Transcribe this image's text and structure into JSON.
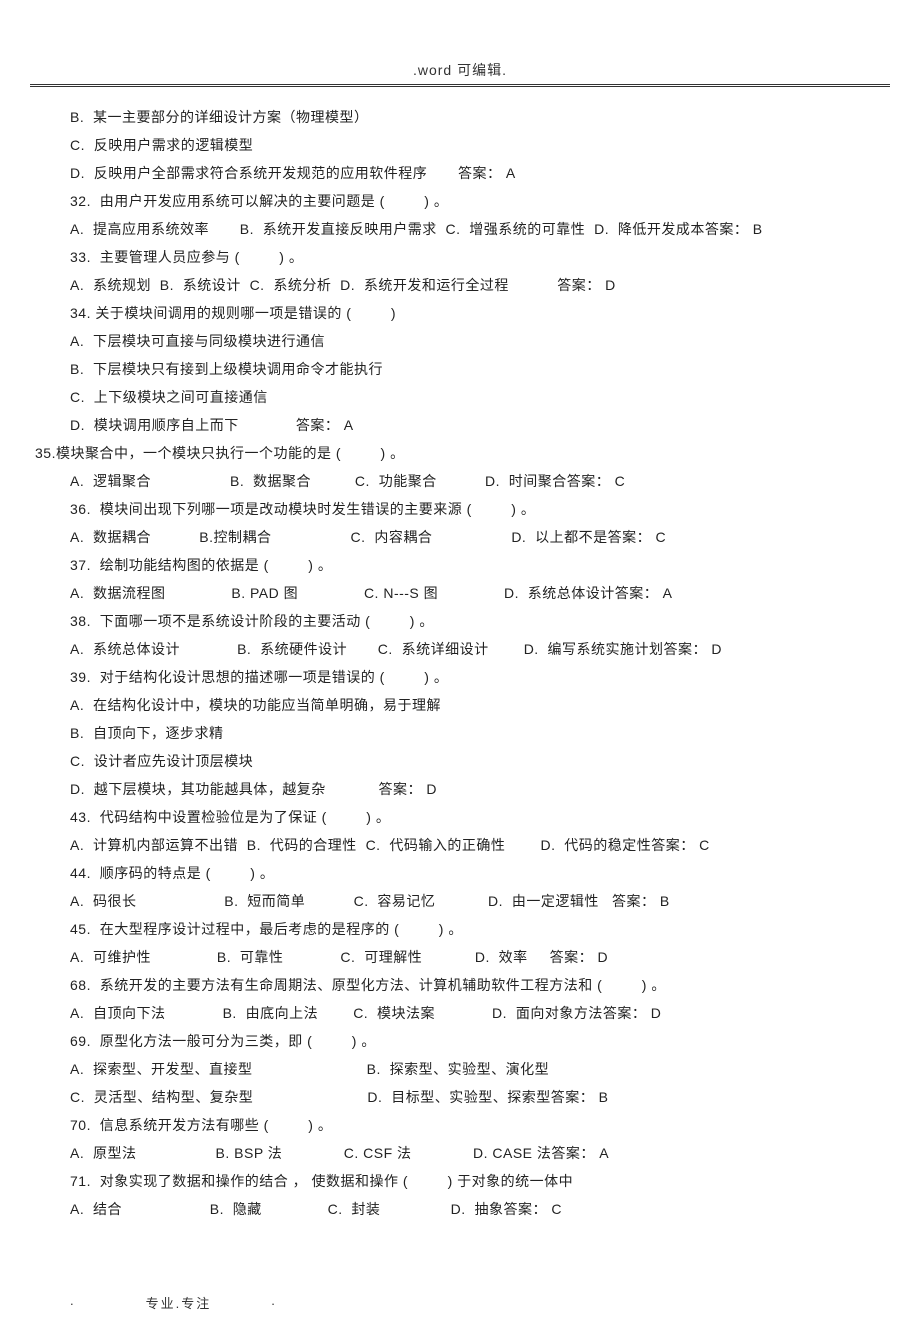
{
  "header": ".word 可编辑.",
  "lines": [
    "B.  某一主要部分的详细设计方案（物理模型）",
    "C.  反映用户需求的逻辑模型",
    "D.  反映用户全部需求符合系统开发规范的应用软件程序       答案： A",
    "32.  由用户开发应用系统可以解决的主要问题是 (         ) 。",
    "A.  提高应用系统效率       B.  系统开发直接反映用户需求  C.  增强系统的可靠性  D.  降低开发成本答案： B",
    "33.  主要管理人员应参与 (         ) 。",
    "A.  系统规划  B.  系统设计  C.  系统分析  D.  系统开发和运行全过程           答案： D",
    "34. 关于模块间调用的规则哪一项是错误的 (         )",
    "A.  下层模块可直接与同级模块进行通信",
    "B.  下层模块只有接到上级模块调用命令才能执行",
    "C.  上下级模块之间可直接通信",
    "D.  模块调用顺序自上而下             答案： A",
    "35.模块聚合中，一个模块只执行一个功能的是 (         ) 。",
    "A.  逻辑聚合                  B.  数据聚合          C.  功能聚合           D.  时间聚合答案： C",
    "36.  模块间出现下列哪一项是改动模块时发生错误的主要来源 (         ) 。",
    "A.  数据耦合           B.控制耦合                  C.  内容耦合                  D.  以上都不是答案： C",
    "37.  绘制功能结构图的依据是 (         ) 。",
    "A.  数据流程图               B. PAD 图               C. N---S 图               D.  系统总体设计答案： A",
    "38.  下面哪一项不是系统设计阶段的主要活动 (         ) 。",
    "A.  系统总体设计             B.  系统硬件设计       C.  系统详细设计        D.  编写系统实施计划答案： D",
    "39.  对于结构化设计思想的描述哪一项是错误的 (         ) 。",
    "A.  在结构化设计中，模块的功能应当简单明确，易于理解",
    "B.  自顶向下，逐步求精",
    "C.  设计者应先设计顶层模块",
    "D.  越下层模块，其功能越具体，越复杂            答案： D",
    "43.  代码结构中设置检验位是为了保证 (         ) 。",
    "A.  计算机内部运算不出错  B.  代码的合理性  C.  代码输入的正确性        D.  代码的稳定性答案： C",
    "44.  顺序码的特点是 (         ) 。",
    "A.  码很长                    B.  短而简单           C.  容易记忆            D.  由一定逻辑性   答案： B",
    "45.  在大型程序设计过程中，最后考虑的是程序的 (         ) 。",
    "A.  可维护性               B.  可靠性             C.  可理解性            D.  效率     答案： D",
    "68.  系统开发的主要方法有生命周期法、原型化方法、计算机辅助软件工程方法和 (         ) 。",
    "A.  自顶向下法             B.  由底向上法        C.  模块法案             D.  面向对象方法答案： D",
    "69.  原型化方法一般可分为三类，即 (         ) 。",
    "A.  探索型、开发型、直接型                          B.  探索型、实验型、演化型",
    "C.  灵活型、结构型、复杂型                          D.  目标型、实验型、探索型答案： B",
    "70.  信息系统开发方法有哪些 (         ) 。",
    "A.  原型法                  B. BSP 法              C. CSF 法              D. CASE 法答案： A",
    "71.  对象实现了数据和操作的结合 ， 使数据和操作 (         ) 于对象的统一体中",
    "A.  结合                    B.  隐藏               C.  封装                D.  抽象答案： C"
  ],
  "q35_index": 12,
  "footer": {
    "left": ".",
    "center": "专业.专注",
    "right": "."
  }
}
